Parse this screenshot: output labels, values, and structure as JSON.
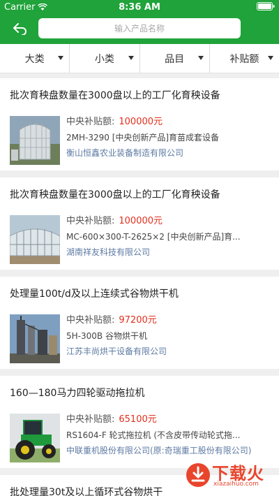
{
  "status_bar": {
    "carrier": "Carrier",
    "time": "8:36 AM"
  },
  "search": {
    "placeholder": "输入产品名称"
  },
  "filters": [
    {
      "label": "大类"
    },
    {
      "label": "小类"
    },
    {
      "label": "品目"
    },
    {
      "label": "补贴额"
    }
  ],
  "subsidy_label": "中央补贴额:",
  "products": [
    {
      "title": "批次育秧盘数量在3000盘以上的工厂化育秧设备",
      "amount": "100000元",
      "model": "2MH-3290 [中央创新产品]育苗成套设备",
      "company": "衡山恒鑫农业装备制造有限公司",
      "image": "greenhouse-large"
    },
    {
      "title": "批次育秧盘数量在3000盘以上的工厂化育秧设备",
      "amount": "100000元",
      "model": "MC-600×300-T-2625×2 [中央创新产品]育...",
      "company": "湖南祥友科技有限公司",
      "image": "greenhouse-tunnel"
    },
    {
      "title": "处理量100t/d及以上连续式谷物烘干机",
      "amount": "97200元",
      "model": "5H-300B 谷物烘干机",
      "company": "江苏丰尚烘干设备有限公司",
      "image": "grain-dryer"
    },
    {
      "title": "160—180马力四轮驱动拖拉机",
      "amount": "65100元",
      "model": "RS1604-F 轮式拖拉机 (不含皮带传动轮式拖...",
      "company": "中联重机股份有限公司(原:奇瑞重工股份有限公司)",
      "image": "tractor"
    }
  ],
  "partial_title": "批处理量30t及以上循环式谷物烘干",
  "watermark": {
    "main": "下载火",
    "sub": "xiazaihuo.com"
  }
}
